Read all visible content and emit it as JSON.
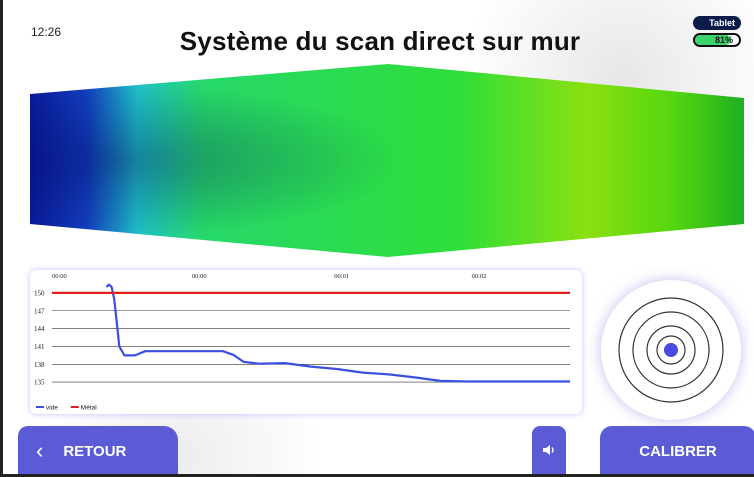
{
  "status": {
    "time": "12:26",
    "device_label": "Tablet",
    "battery_text": "81%",
    "battery_level": 0.81
  },
  "title": "Système du scan direct sur mur",
  "colors": {
    "accent": "#5b5bd6",
    "scan_low": "#0a1a9a",
    "scan_mid": "#26d86a",
    "scan_high": "#7fdc10",
    "series_vide": "#3b4fe0",
    "series_metal": "#e02020"
  },
  "chart_data": {
    "type": "line",
    "x_ticks": [
      "00:00",
      "00:00",
      "00:01",
      "00:02"
    ],
    "ylim": [
      133,
      151.5
    ],
    "y_ticks": [
      150,
      147,
      144,
      141,
      138,
      135
    ],
    "x": [
      0,
      0.25,
      0.45,
      0.9,
      1.05,
      1.1,
      1.15,
      1.2,
      1.25,
      1.3,
      1.4,
      1.6,
      1.8,
      2.0,
      2.5,
      3.0,
      3.3,
      3.5,
      3.7,
      4.0,
      4.5,
      5.0,
      5.5,
      6.0,
      6.5,
      7.0,
      7.5,
      8.0,
      8.5,
      9.0,
      9.5,
      10.0
    ],
    "series": [
      {
        "name": "vide",
        "values": [
          null,
          null,
          null,
          null,
          151,
          151.4,
          151,
          149,
          145,
          141,
          139.5,
          139.5,
          140.2,
          140.2,
          140.2,
          140.2,
          140.2,
          139.6,
          138.4,
          138.1,
          138.2,
          137.6,
          137.2,
          136.6,
          136.3,
          135.8,
          135.2,
          135.1,
          135.1,
          135.1,
          135.1,
          135.1
        ]
      },
      {
        "name": "Métal",
        "values": [
          150,
          150,
          150,
          150,
          150,
          150,
          150,
          150,
          150,
          150,
          150,
          150,
          150,
          150,
          150,
          150,
          150,
          150,
          150,
          150,
          150,
          150,
          150,
          150,
          150,
          150,
          150,
          150,
          150,
          150,
          150,
          150
        ]
      }
    ],
    "legend": [
      "vide",
      "Métal"
    ]
  },
  "buttons": {
    "back_label": "RETOUR",
    "back_icon": "chevron-left-icon",
    "sound_icon": "speaker-icon",
    "calibrate_label": "CALIBRER"
  }
}
